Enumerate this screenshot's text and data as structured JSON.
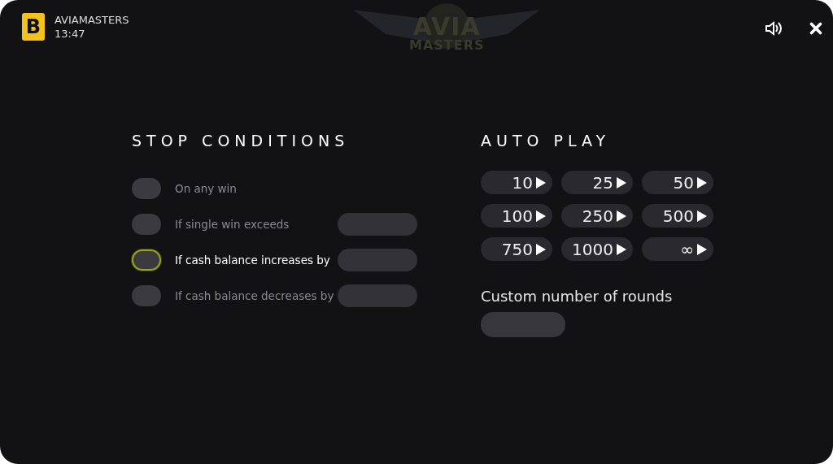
{
  "header": {
    "brand_letter": "B",
    "game_name": "AVIAMASTERS",
    "time": "13:47",
    "logo": {
      "line_1": "AVIA",
      "line_2": "MASTERS"
    }
  },
  "stop_conditions": {
    "title": "STOP CONDITIONS",
    "items": [
      {
        "label": "On any win",
        "kind": "toggle",
        "focused": false
      },
      {
        "label": "If single win exceeds",
        "kind": "toggle_field",
        "focused": false
      },
      {
        "label": "If cash balance increases by",
        "kind": "toggle_field",
        "focused": true
      },
      {
        "label": "If cash balance decreases by",
        "kind": "toggle_field",
        "focused": false
      }
    ]
  },
  "auto_play": {
    "title": "AUTO PLAY",
    "options": [
      "10",
      "25",
      "50",
      "100",
      "250",
      "500",
      "750",
      "1000",
      "∞"
    ],
    "custom_label": "Custom number of rounds"
  }
}
